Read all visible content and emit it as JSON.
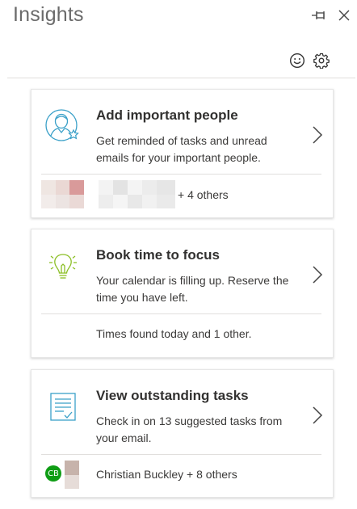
{
  "header": {
    "title": "Insights",
    "pin_icon": "pin-icon",
    "close_icon": "close-icon",
    "feedback_icon": "smiley-icon",
    "settings_icon": "gear-icon"
  },
  "cards": [
    {
      "title": "Add important people",
      "description": "Get reminded of tasks and unread emails for your important people.",
      "footer": "+ 4 others",
      "icon": "person-star-icon",
      "accent": "#3aa0c8"
    },
    {
      "title": "Book time to focus",
      "description": "Your calendar is filling up. Reserve the time you have left.",
      "footer": "Times found today and 1 other.",
      "icon": "lightbulb-icon",
      "accent": "#8cbf26"
    },
    {
      "title": "View outstanding tasks",
      "description": "Check in on 13 suggested tasks from your email.",
      "footer": "Christian Buckley + 8 others",
      "avatar_initials": "CB",
      "icon": "document-check-icon",
      "accent": "#3aa0c8"
    }
  ]
}
